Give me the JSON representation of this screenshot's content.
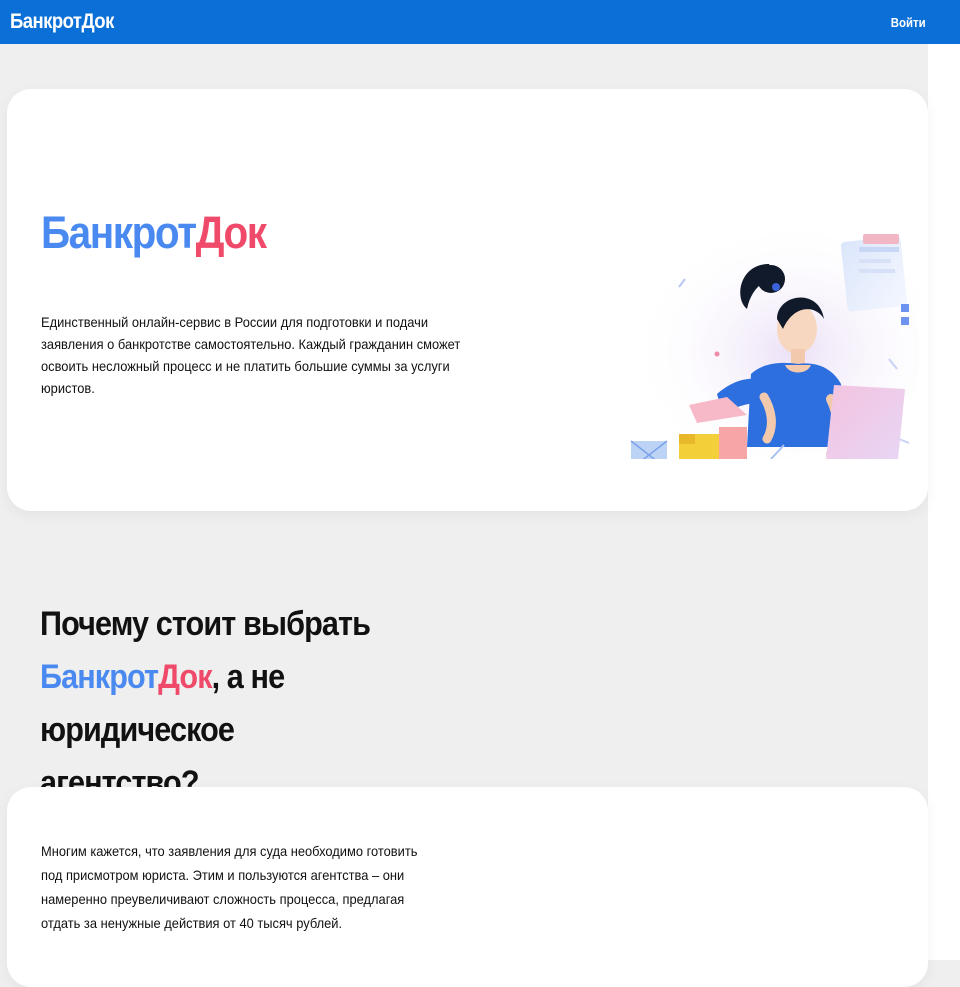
{
  "header": {
    "logo": "БанкротДок",
    "login_label": "Войти",
    "color": "#0a6fd6"
  },
  "hero": {
    "brand_part1": "Банкрот",
    "brand_part2": "Док",
    "description": "Единственный онлайн-сервис в России для подготовки и подачи заявления о банкротстве самостоятельно. Каждый гражданин сможет освоить несложный процесс и не платить большие суммы за услуги юристов.",
    "illustration": "woman-with-laptop-and-boxes"
  },
  "why": {
    "line1": "Почему стоит выбрать",
    "brand_part1": "Банкрот",
    "brand_part2": "Док",
    "line2_rest": ", а не юридическое",
    "line3": "агентство?"
  },
  "card2": {
    "text": "Многим кажется, что заявления для суда необходимо готовить под присмотром юриста. Этим и пользуются агентства – они намеренно преувеличивают сложность процесса, предлагая отдать за ненужные действия от 40 тысяч рублей."
  },
  "colors": {
    "brand_blue": "#4a8af0",
    "brand_red": "#f04a6a",
    "background": "#efefef"
  }
}
